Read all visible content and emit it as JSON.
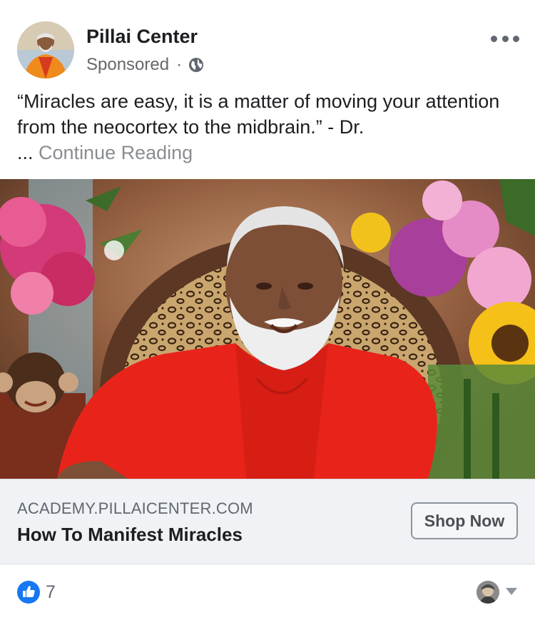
{
  "post": {
    "author": "Pillai Center",
    "sponsored": "Sponsored",
    "separator": "·",
    "text": "“Miracles are easy, it is a matter of moving your attention from the neocortex to the midbrain.” - Dr.",
    "ellipsis": "...",
    "continue_reading": "Continue Reading"
  },
  "link_card": {
    "domain": "ACADEMY.PILLAICENTER.COM",
    "title": "How To Manifest Miracles",
    "cta": "Shop Now"
  },
  "reactions": {
    "count": "7"
  },
  "icons": {
    "privacy": "globe-icon",
    "menu": "more-icon",
    "reaction": "thumbs-up-icon",
    "dropdown": "caret-down-icon"
  },
  "colors": {
    "like_blue": "#1877f2",
    "secondary_text": "#65676b",
    "card_background": "#f0f2f5"
  }
}
